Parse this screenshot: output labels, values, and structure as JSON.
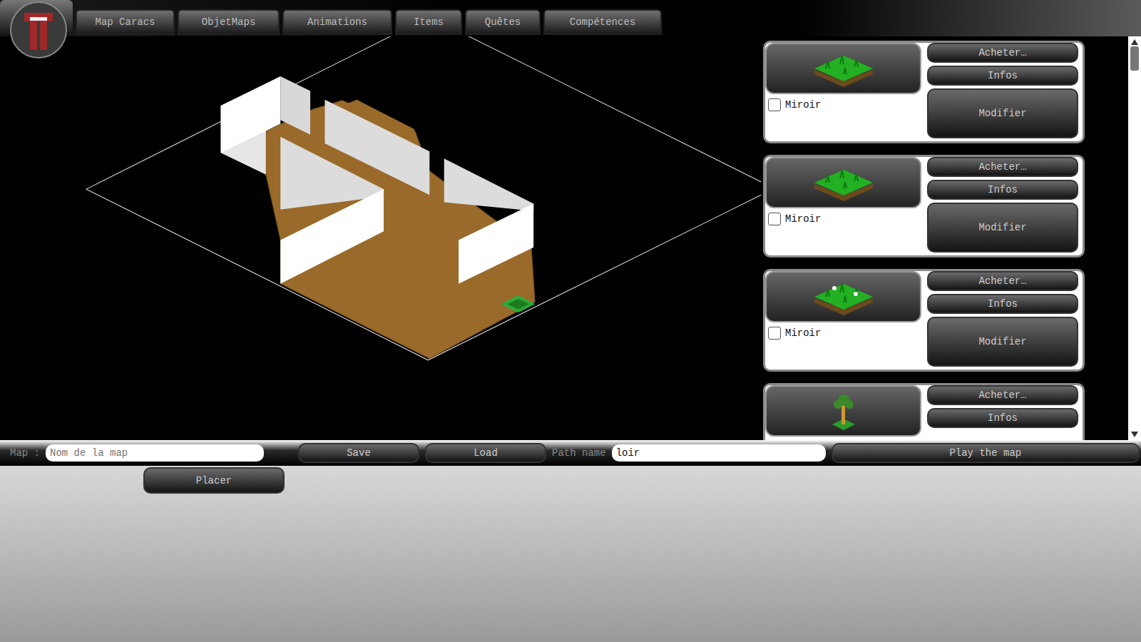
{
  "tabs": [
    {
      "label": "Map Caracs",
      "selected": false
    },
    {
      "label": "ObjetMaps",
      "selected": false
    },
    {
      "label": "Animations",
      "selected": false
    },
    {
      "label": "Items",
      "selected": false
    },
    {
      "label": "Quêtes",
      "selected": false
    },
    {
      "label": "Compétences",
      "selected": false
    }
  ],
  "objects": [
    {
      "kind": "grass",
      "mirror": {
        "label": "Miroir",
        "checked": false
      },
      "buttons": [
        "Acheter…",
        "Infos",
        "Modifier"
      ]
    },
    {
      "kind": "grass",
      "mirror": {
        "label": "Miroir",
        "checked": false
      },
      "buttons": [
        "Acheter…",
        "Infos",
        "Modifier"
      ]
    },
    {
      "kind": "flowers",
      "mirror": {
        "label": "Miroir",
        "checked": false
      },
      "buttons": [
        "Acheter…",
        "Infos",
        "Modifier"
      ]
    },
    {
      "kind": "tree",
      "mirror": {
        "checked": false
      },
      "buttons": [
        "Acheter…",
        "Infos"
      ]
    }
  ],
  "map_field": {
    "label": "Map :",
    "placeholder": "Nom de la map",
    "value": ""
  },
  "save": "Save",
  "load": "Load",
  "path_field": {
    "label": "Path name",
    "value": "loir"
  },
  "play": "Play the map",
  "place": "Placer"
}
